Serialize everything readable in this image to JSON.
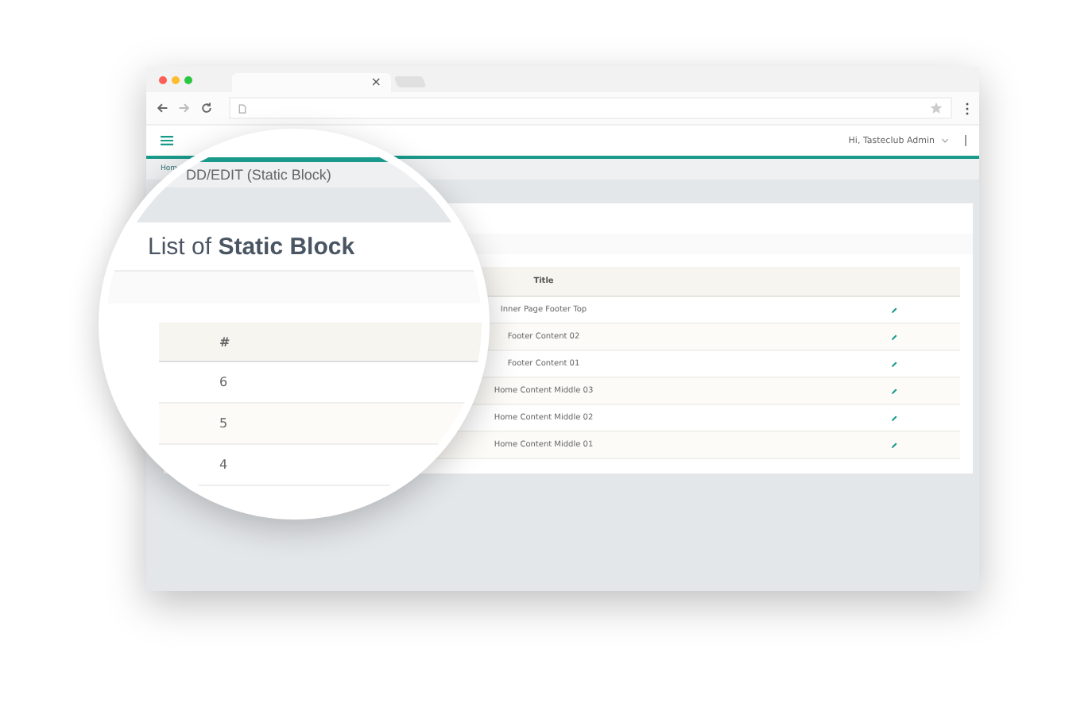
{
  "browser": {
    "tab_close": "×"
  },
  "header": {
    "greeting": "Hi, Tasteclub Admin"
  },
  "breadcrumb": {
    "home": "Hom"
  },
  "table": {
    "columns": [
      "Title"
    ],
    "rows": [
      {
        "title": "Inner Page Footer Top"
      },
      {
        "title": "Footer Content 02"
      },
      {
        "title": "Footer Content 01"
      },
      {
        "title": "Home Content Middle 03"
      },
      {
        "title": "Home Content Middle 02"
      },
      {
        "title": "Home Content Middle 01"
      }
    ]
  },
  "magnifier": {
    "breadcrumb": "DD/EDIT (Static Block)",
    "heading": "List of **Static Block**",
    "column": "#",
    "rows": [
      "6",
      "5",
      "4"
    ]
  }
}
